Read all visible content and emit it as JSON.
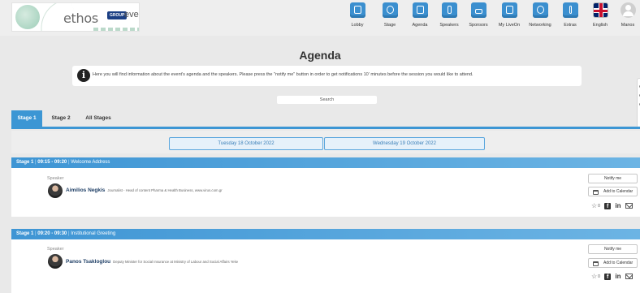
{
  "header": {
    "logo_word": "ethos",
    "logo_badge": "GROUP",
    "logo_event": "event",
    "nav": [
      {
        "label": "Lobby",
        "icon": "building-icon"
      },
      {
        "label": "Stage",
        "icon": "stage-icon"
      },
      {
        "label": "Agenda",
        "icon": "agenda-icon"
      },
      {
        "label": "Speakers",
        "icon": "speakers-icon"
      },
      {
        "label": "Sponsors",
        "icon": "sponsors-icon"
      },
      {
        "label": "My LiveOn",
        "icon": "myliveon-icon"
      },
      {
        "label": "Networking",
        "icon": "networking-icon"
      },
      {
        "label": "Extras",
        "icon": "extras-icon"
      },
      {
        "label": "English",
        "icon": "uk-flag-icon"
      },
      {
        "label": "Manos",
        "icon": "user-avatar-icon"
      }
    ]
  },
  "page": {
    "title": "Agenda",
    "info_text": "Here you will find information about the event's agenda and the speakers. Please press the \"notify me\" button in order to get notifications 10' minutes before the session you would like to attend.",
    "search_placeholder": "Search"
  },
  "tabs": [
    "Stage 1",
    "Stage 2",
    "All Stages"
  ],
  "dates": [
    "Tuesday 18 October 2022",
    "Wednesday 19 October 2022"
  ],
  "sessions": [
    {
      "stage": "Stage 1",
      "time": "09:15 - 09:20",
      "title": "Welcome Address",
      "speaker_label": "Speaker",
      "speaker_name": "Aimilios Negkis",
      "speaker_role": "Journalist - Head of content Pharma & Health Business, www.virus.com.gr",
      "notify_label": "Notify me",
      "calendar_label": "Add to Calendar",
      "favorites_count": "0"
    },
    {
      "stage": "Stage 1",
      "time": "09:20 - 09:30",
      "title": "Institutional Greeting",
      "speaker_label": "Speaker",
      "speaker_name": "Panos Tsakloglou",
      "speaker_role": "Deputy Minister for Social Insurance at Ministry of Labour and Social Affairs Yeke",
      "notify_label": "Notify me",
      "calendar_label": "Add to Calendar",
      "favorites_count": "0"
    }
  ],
  "colors": {
    "accent": "#3c96d4",
    "nav_icon": "#3b8fcf",
    "speaker_name": "#1f3f66"
  }
}
